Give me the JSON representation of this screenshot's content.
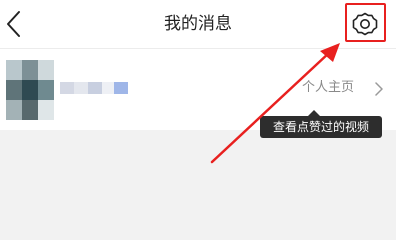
{
  "header": {
    "title": "我的消息",
    "back_icon": "chevron-left-icon",
    "settings_icon": "gear-icon"
  },
  "user": {
    "name": "",
    "profile_link_label": "个人主页",
    "profile_icon": "chevron-right-icon"
  },
  "tooltip": {
    "text": "查看点赞过的视频"
  },
  "annotation": {
    "color": "#e8201f"
  }
}
